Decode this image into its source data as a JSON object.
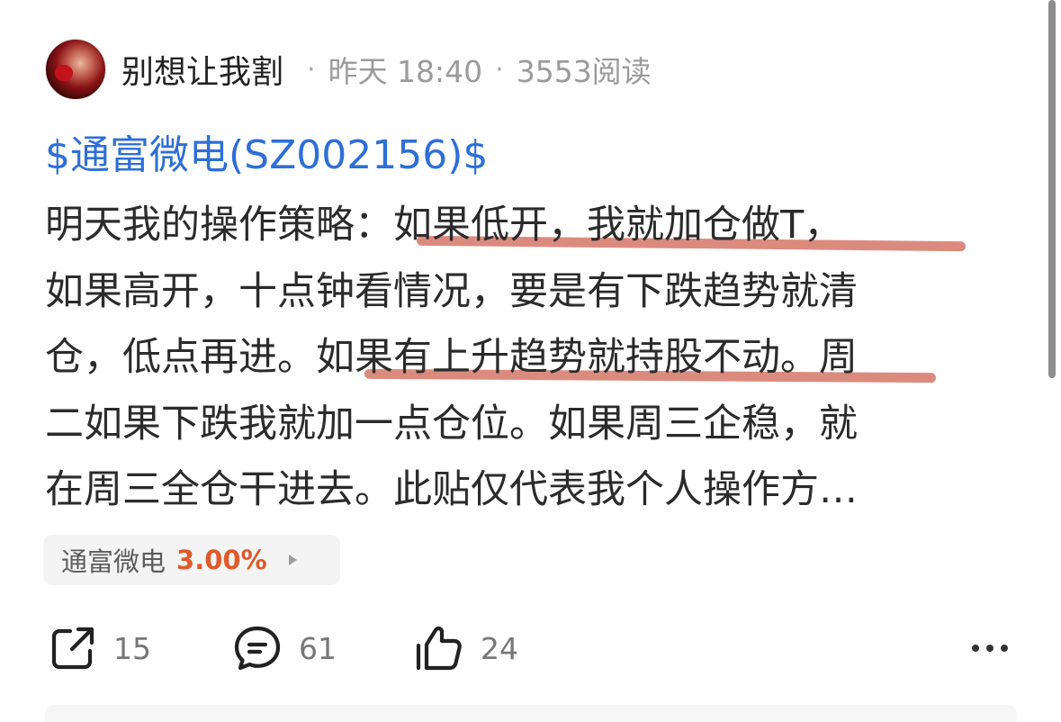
{
  "post": {
    "author": "别想让我割",
    "time": "昨天 18:40",
    "reads": "3553阅读",
    "separator": "·",
    "stock_link": "$通富微电(SZ002156)$",
    "body_lines": [
      {
        "pre": "明天我的操作策略：",
        "hl": "如果低开，我就加仓做T，",
        "post": ""
      },
      {
        "pre": "如果高开，十点钟看情况，要是有下跌趋势就清",
        "hl": "",
        "post": ""
      },
      {
        "pre": "仓，低点再进。",
        "hl": "如果有上升趋势就持股不动。",
        "post": "周"
      },
      {
        "pre": "二如果下跌我就加一点仓位。如果周三企稳，就",
        "hl": "",
        "post": ""
      },
      {
        "pre": "在周三全仓干进去。此贴仅代表我个人操作方…",
        "hl": "",
        "post": ""
      }
    ]
  },
  "stock_tag": {
    "name": "通富微电",
    "change": "3.00%",
    "change_color": "#e05a2b"
  },
  "actions": {
    "share_count": "15",
    "comment_count": "61",
    "like_count": "24",
    "share_icon": "share-icon",
    "comment_icon": "comment-icon",
    "like_icon": "thumbs-up-icon",
    "more_icon": "more-icon"
  },
  "colors": {
    "link": "#2e6fd6",
    "underline": "#d98577",
    "text": "#2b2b2b",
    "meta": "#9b9b9b"
  }
}
